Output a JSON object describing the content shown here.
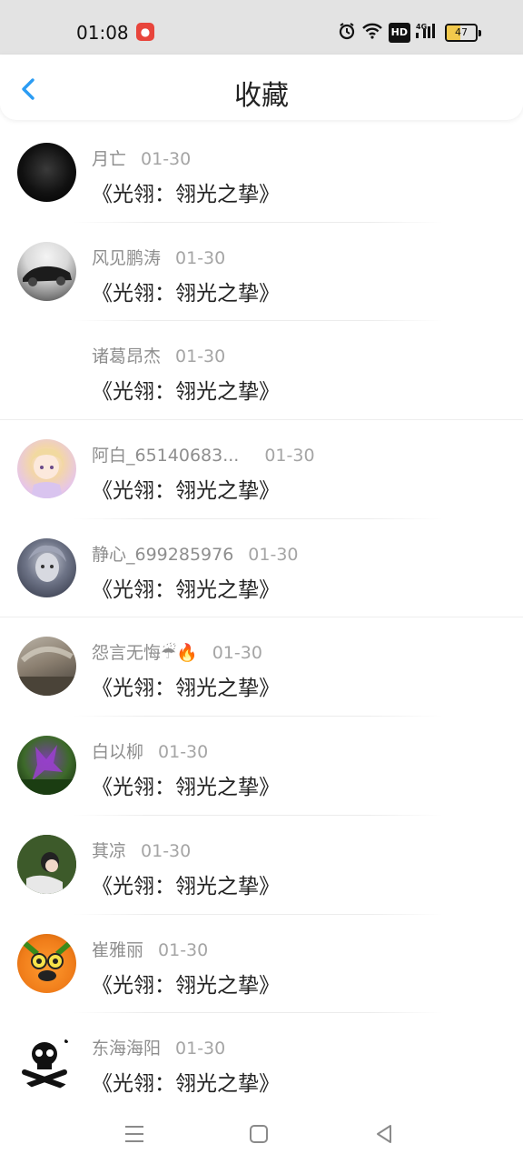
{
  "status_bar": {
    "time": "01:08",
    "battery": "47",
    "battery_level": 0.47,
    "icons": [
      "app-notification-icon",
      "alarm-icon",
      "wifi-icon",
      "hd-icon",
      "4g-signal-icon",
      "battery-icon"
    ]
  },
  "header": {
    "title": "收藏",
    "back_icon": "chevron-left-icon",
    "accent": "#2b9cf3"
  },
  "items": [
    {
      "name": "月亡",
      "date": "01-30",
      "message": "《光翎：翎光之挚》",
      "has_avatar": true
    },
    {
      "name": "风见鹏涛",
      "date": "01-30",
      "message": "《光翎：翎光之挚》",
      "has_avatar": true
    },
    {
      "name": "诸葛昂杰",
      "date": "01-30",
      "message": "《光翎：翎光之挚》",
      "has_avatar": false
    },
    {
      "name": "阿白_65140683...",
      "date": "01-30",
      "message": "《光翎：翎光之挚》",
      "has_avatar": true
    },
    {
      "name": "静心_699285976",
      "date": "01-30",
      "message": "《光翎：翎光之挚》",
      "has_avatar": true
    },
    {
      "name": "怨言无悔☔🔥",
      "date": "01-30",
      "message": "《光翎：翎光之挚》",
      "has_avatar": true
    },
    {
      "name": "白以柳",
      "date": "01-30",
      "message": "《光翎：翎光之挚》",
      "has_avatar": true
    },
    {
      "name": "萁凉",
      "date": "01-30",
      "message": "《光翎：翎光之挚》",
      "has_avatar": true
    },
    {
      "name": "崔雅丽",
      "date": "01-30",
      "message": "《光翎：翎光之挚》",
      "has_avatar": true
    },
    {
      "name": "东海海阳",
      "date": "01-30",
      "message": "《光翎：翎光之挚》",
      "has_avatar": true
    }
  ],
  "nav_bar": {
    "icons": [
      "menu-icon",
      "home-icon",
      "back-triangle-icon"
    ]
  }
}
